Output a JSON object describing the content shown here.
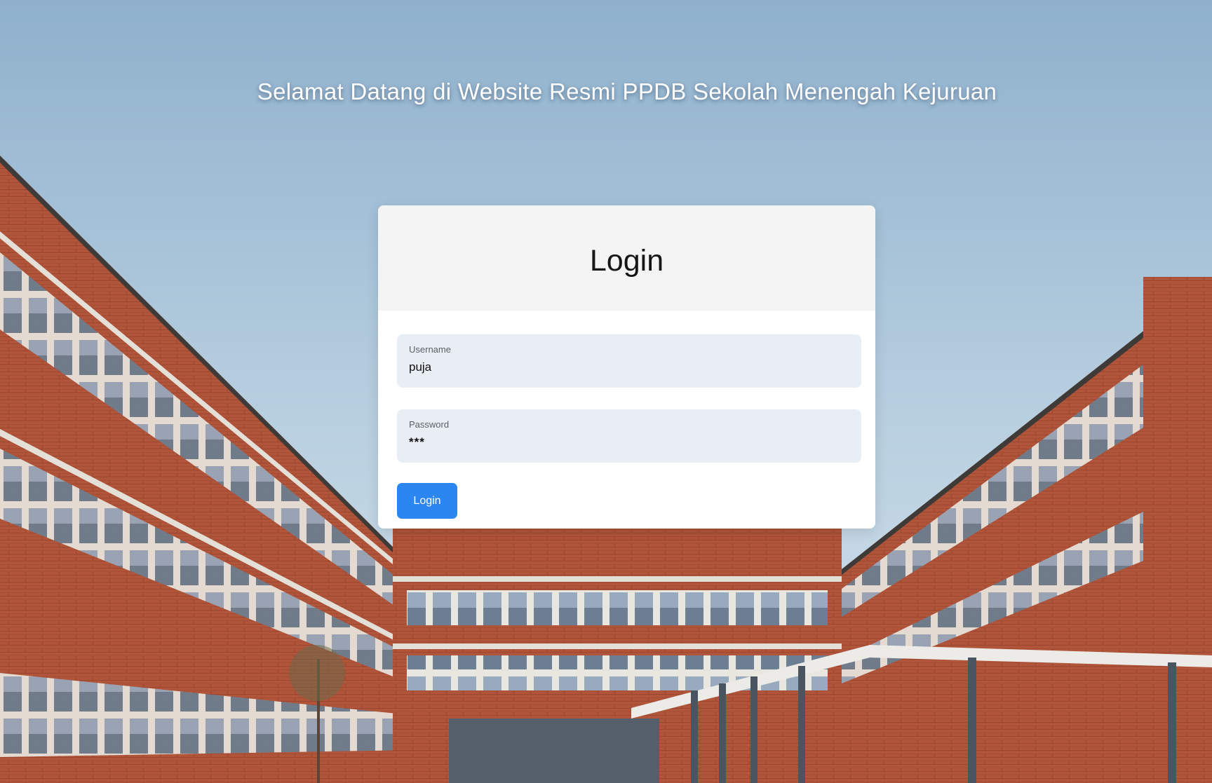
{
  "page": {
    "welcome_text": "Selamat Datang di Website Resmi PPDB Sekolah Menengah Kejuruan"
  },
  "login_card": {
    "title": "Login",
    "username": {
      "label": "Username",
      "value": "puja"
    },
    "password": {
      "label": "Password",
      "value": "***"
    },
    "submit_label": "Login"
  },
  "colors": {
    "button": "#2c86f1",
    "field_background": "#e8eef4",
    "card_header": "#f4f4f4",
    "sky": "#a6c2d8",
    "brick": "#b2553b"
  }
}
